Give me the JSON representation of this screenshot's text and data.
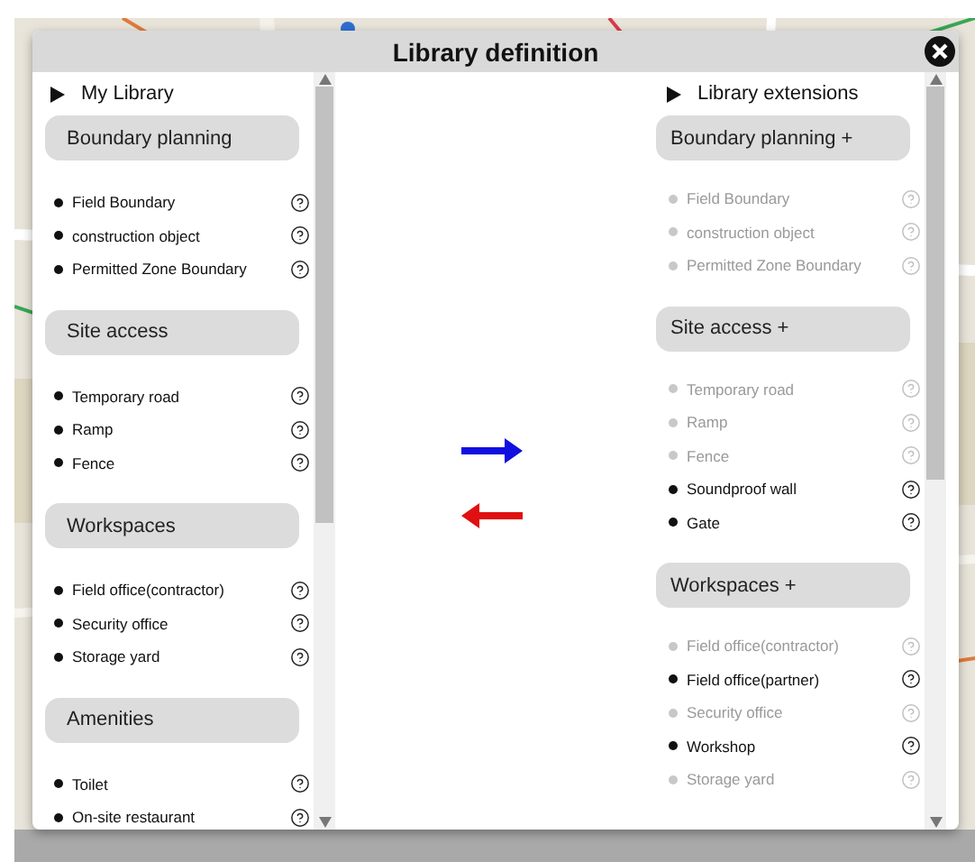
{
  "dialog": {
    "title": "Library definition"
  },
  "my_library": {
    "heading": "My Library",
    "groups": [
      {
        "title": "Boundary planning",
        "items": [
          {
            "label": "Field Boundary",
            "disabled": false
          },
          {
            "label": "construction object",
            "disabled": false
          },
          {
            "label": "Permitted Zone Boundary",
            "disabled": false
          }
        ]
      },
      {
        "title": "Site access",
        "items": [
          {
            "label": "Temporary road",
            "disabled": false
          },
          {
            "label": "Ramp",
            "disabled": false
          },
          {
            "label": "Fence",
            "disabled": false
          }
        ]
      },
      {
        "title": "Workspaces",
        "items": [
          {
            "label": "Field office(contractor)",
            "disabled": false
          },
          {
            "label": "Security office",
            "disabled": false
          },
          {
            "label": "Storage yard",
            "disabled": false
          }
        ]
      },
      {
        "title": "Amenities",
        "items": [
          {
            "label": "Toilet",
            "disabled": false
          },
          {
            "label": "On-site restaurant",
            "disabled": false
          }
        ]
      }
    ]
  },
  "library_extensions": {
    "heading": "Library extensions",
    "groups": [
      {
        "title": "Boundary planning +",
        "items": [
          {
            "label": "Field Boundary",
            "disabled": true
          },
          {
            "label": "construction object",
            "disabled": true
          },
          {
            "label": "Permitted Zone Boundary",
            "disabled": true
          }
        ]
      },
      {
        "title": "Site access +",
        "items": [
          {
            "label": "Temporary road",
            "disabled": true
          },
          {
            "label": "Ramp",
            "disabled": true
          },
          {
            "label": "Fence",
            "disabled": true
          },
          {
            "label": "Soundproof wall",
            "disabled": false
          },
          {
            "label": "Gate",
            "disabled": false
          }
        ]
      },
      {
        "title": "Workspaces +",
        "items": [
          {
            "label": "Field office(contractor)",
            "disabled": true
          },
          {
            "label": "Field office(partner)",
            "disabled": false
          },
          {
            "label": "Security office",
            "disabled": true
          },
          {
            "label": "Workshop",
            "disabled": false
          },
          {
            "label": "Storage yard",
            "disabled": true
          }
        ]
      }
    ]
  }
}
